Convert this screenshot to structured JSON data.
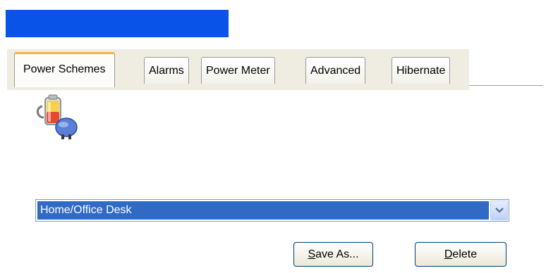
{
  "window": {
    "title": ""
  },
  "tabs": [
    {
      "label": "Power Schemes",
      "active": true
    },
    {
      "label": "Alarms",
      "active": false
    },
    {
      "label": "Power Meter",
      "active": false
    },
    {
      "label": "Advanced",
      "active": false
    },
    {
      "label": "Hibernate",
      "active": false
    }
  ],
  "power_schemes": {
    "icon": "battery-power-plug-icon",
    "scheme_select": {
      "selected": "Home/Office Desk"
    },
    "save_as": {
      "accesskey": "S",
      "rest": "ave As..."
    },
    "delete": {
      "accesskey": "D",
      "rest": "elete"
    }
  },
  "colors": {
    "title_bar": "#0a53e8",
    "selection": "#316ac5",
    "active_tab_accent": "#f7b437"
  }
}
